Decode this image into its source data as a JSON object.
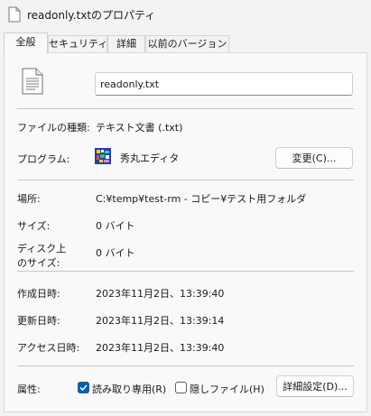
{
  "window": {
    "title": "readonly.txtのプロパティ"
  },
  "tabs": [
    {
      "label": "全般",
      "active": true
    },
    {
      "label": "セキュリティ",
      "active": false
    },
    {
      "label": "詳細",
      "active": false
    },
    {
      "label": "以前のバージョン",
      "active": false
    }
  ],
  "general": {
    "file_name": "readonly.txt",
    "type_label": "ファイルの種類:",
    "type_value": "テキスト文書 (.txt)",
    "program_label": "プログラム:",
    "program_value": "秀丸エディタ",
    "change_button": "変更(C)...",
    "location_label": "場所:",
    "location_value": "C:¥temp¥test-rm - コピー¥テスト用フォルダ",
    "size_label": "サイズ:",
    "size_value": "0 バイト",
    "disk_size_label_1": "ディスク上",
    "disk_size_label_2": "のサイズ:",
    "disk_size_value": "0 バイト",
    "created_label": "作成日時:",
    "created_value": "2023年11月2日、13:39:40",
    "modified_label": "更新日時:",
    "modified_value": "2023年11月2日、13:39:14",
    "accessed_label": "アクセス日時:",
    "accessed_value": "2023年11月2日、13:39:40",
    "attributes_label": "属性:",
    "readonly_label": "読み取り専用(R)",
    "readonly_checked": true,
    "hidden_label": "隠しファイル(H)",
    "hidden_checked": false,
    "advanced_button": "詳細設定(D)..."
  },
  "icons": [
    "text-file-icon",
    "hidemaru-app-icon",
    "checkmark-icon"
  ]
}
